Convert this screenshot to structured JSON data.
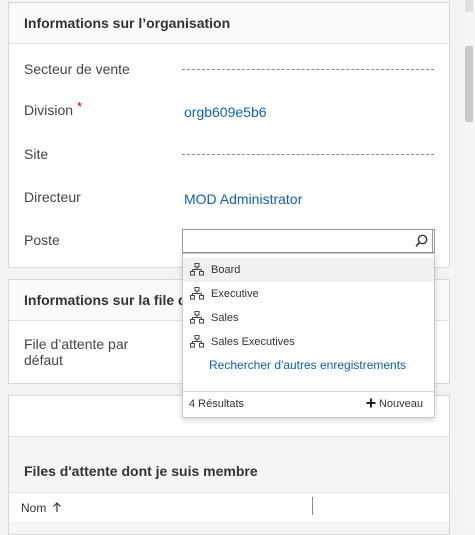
{
  "org_section": {
    "title": "Informations sur l’organisation",
    "fields": {
      "secteur": {
        "label": "Secteur de vente"
      },
      "division": {
        "label": "Division",
        "required_mark": "*",
        "value": "orgb609e5b6"
      },
      "site": {
        "label": "Site"
      },
      "directeur": {
        "label": "Directeur",
        "value": "MOD Administrator"
      },
      "poste": {
        "label": "Poste",
        "value": ""
      }
    }
  },
  "queue_section": {
    "title": "Informations sur la file d'attente",
    "field": {
      "label_line1": "File d’attente par",
      "label_line2": "défaut"
    }
  },
  "member_queues": {
    "title": "Files d'attente dont je suis membre",
    "grid": {
      "column_name": "Nom",
      "sort_icon": "arrow-up-icon"
    }
  },
  "lookup_dropdown": {
    "items": [
      {
        "label": "Board",
        "icon": "hierarchy-icon",
        "selected": true
      },
      {
        "label": "Executive",
        "icon": "hierarchy-icon",
        "selected": false
      },
      {
        "label": "Sales",
        "icon": "hierarchy-icon",
        "selected": false
      },
      {
        "label": "Sales Executives",
        "icon": "hierarchy-icon",
        "selected": false
      }
    ],
    "more_link": "Rechercher d'autres enregistrements",
    "results_count": "4 Résultats",
    "new_label": "Nouveau"
  },
  "colors": {
    "link": "#1160b7",
    "required": "#c00000"
  }
}
